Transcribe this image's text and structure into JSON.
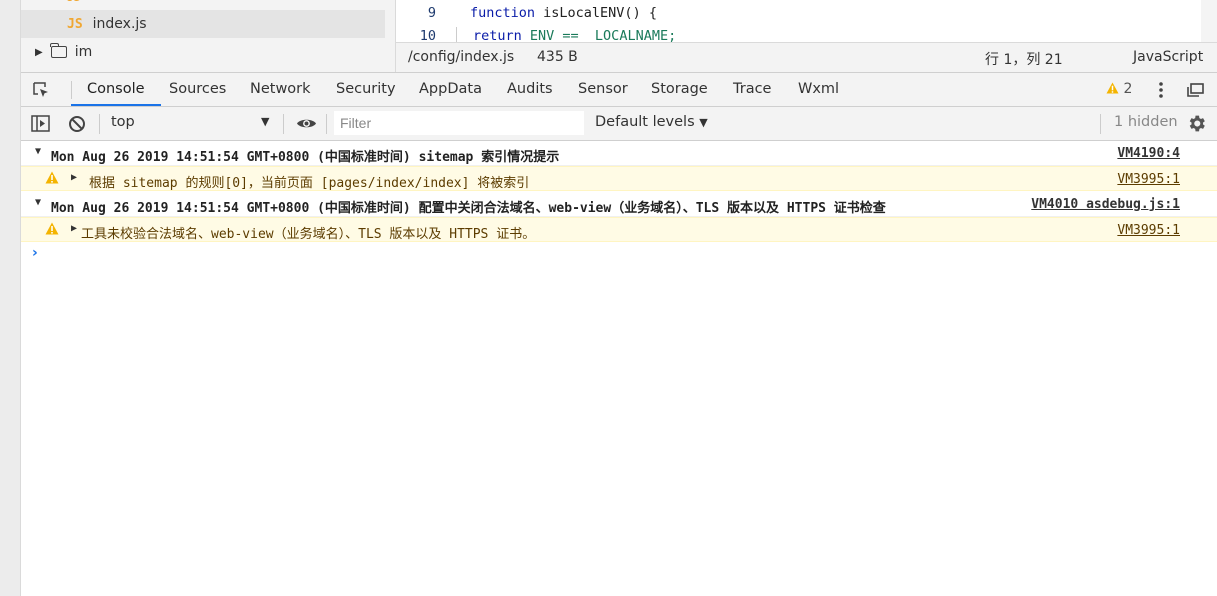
{
  "file_tree": {
    "items": [
      {
        "label": "index.js",
        "type": "js",
        "badge": "JS"
      },
      {
        "label": "im",
        "type": "folder"
      }
    ]
  },
  "code": {
    "lines": [
      {
        "num": "9",
        "keyword": "function",
        "rest": " isLocalENV() {"
      },
      {
        "num": "10",
        "keyword": "return",
        "rest": " ENV ==  LOCALNAME;"
      }
    ]
  },
  "status_bar": {
    "path": "/config/index.js",
    "size": "435 B",
    "position": "行 1，列 21",
    "language": "JavaScript"
  },
  "tabs": [
    "Console",
    "Sources",
    "Network",
    "Security",
    "AppData",
    "Audits",
    "Sensor",
    "Storage",
    "Trace",
    "Wxml"
  ],
  "active_tab": "Console",
  "warning_count": "2",
  "toolbar": {
    "context": "top",
    "filter_placeholder": "Filter",
    "levels": "Default levels",
    "hidden": "1 hidden"
  },
  "messages": [
    {
      "kind": "group",
      "text": "Mon Aug 26 2019 14:51:54 GMT+0800 (中国标准时间) sitemap 索引情况提示",
      "source": "VM4190:4"
    },
    {
      "kind": "warn",
      "text": "根据 sitemap 的规则[0]，当前页面 [pages/index/index] 将被索引",
      "source": "VM3995:1"
    },
    {
      "kind": "group",
      "text": "Mon Aug 26 2019 14:51:54 GMT+0800 (中国标准时间) 配置中关闭合法域名、web-view（业务域名）、TLS 版本以及 HTTPS 证书检查",
      "source": "VM4010 asdebug.js:1"
    },
    {
      "kind": "warn",
      "text": "工具未校验合法域名、web-view（业务域名）、TLS 版本以及 HTTPS 证书。",
      "source": "VM3995:1"
    }
  ],
  "colors": {
    "accent": "#1a73e8",
    "warning_bg": "#fffbe5",
    "warning_icon": "#f4b400",
    "js_badge": "#f0a732"
  }
}
